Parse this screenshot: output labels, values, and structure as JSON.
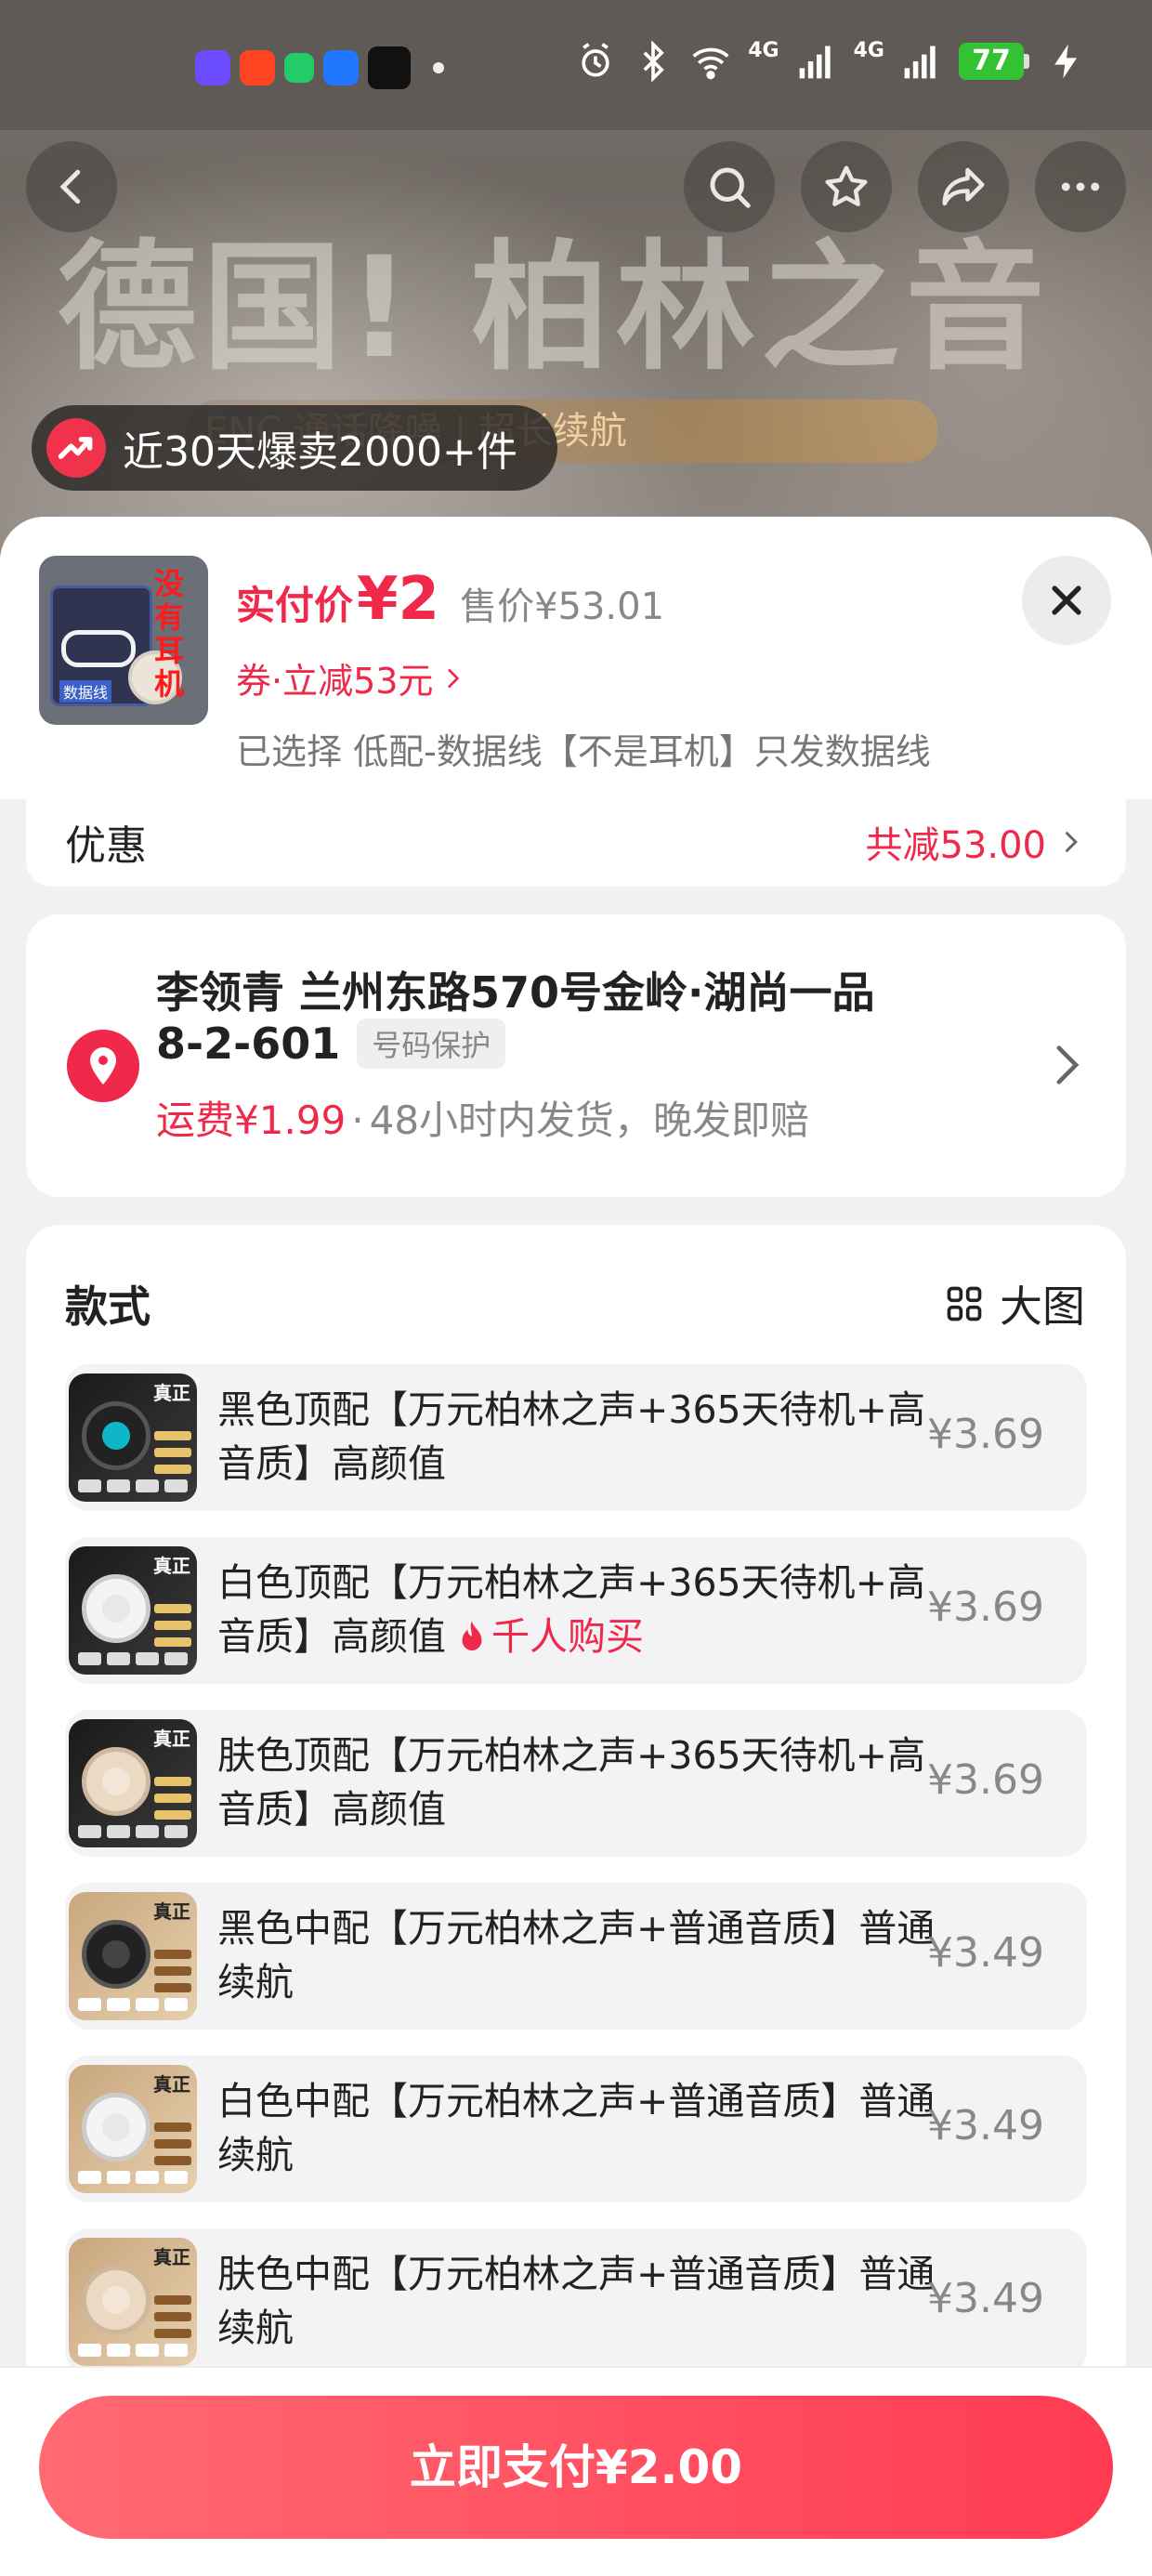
{
  "status_bar": {
    "battery": "77",
    "signal_label_1": "4G",
    "signal_label_2": "4G",
    "app_icon_colors": [
      "#6b4cff",
      "#ff4422",
      "#22cc66",
      "#2277ff",
      "#111111"
    ]
  },
  "backdrop": {
    "hero_text": "德国! 柏林之音",
    "hero_sub": "ENC 通话降噪 | 超长续航",
    "sales_badge": "近30天爆卖2000+件"
  },
  "nav": {
    "back_icon": "chevron-left-icon",
    "search_icon": "search-icon",
    "favorite_icon": "star-icon",
    "share_icon": "share-icon",
    "more_icon": "more-icon"
  },
  "product": {
    "thumb_text": "没有耳机",
    "thumb_label": "数据线",
    "price_label": "实付价",
    "price_value": "¥2",
    "original_price": "售价¥53.01",
    "coupon": "券·立减53元",
    "selected": "已选择 低配-数据线【不是耳机】只发数据线"
  },
  "discount": {
    "label": "优惠",
    "amount": "共减53.00"
  },
  "address": {
    "line1": "李领青  兰州东路570号金岭·湖尚一品",
    "line2": "8-2-601",
    "privacy_tag": "号码保护",
    "shipping_fee": "运费¥1.99",
    "separator": "·",
    "shipping_note": "48小时内发货，晚发即赔"
  },
  "styles": {
    "title": "款式",
    "big_view": "大图",
    "variants": [
      {
        "name": "黑色顶配【万元柏林之声+365天待机+高音质】高颜值",
        "price": "¥3.69",
        "badge": ""
      },
      {
        "name": "白色顶配【万元柏林之声+365天待机+高音质】高颜值",
        "price": "¥3.69",
        "badge": "千人购买"
      },
      {
        "name": "肤色顶配【万元柏林之声+365天待机+高音质】高颜值",
        "price": "¥3.69",
        "badge": ""
      },
      {
        "name": "黑色中配【万元柏林之声+普通音质】普通续航",
        "price": "¥3.49",
        "badge": ""
      },
      {
        "name": "白色中配【万元柏林之声+普通音质】普通续航",
        "price": "¥3.49",
        "badge": ""
      },
      {
        "name": "肤色中配【万元柏林之声+普通音质】普通续航",
        "price": "¥3.49",
        "badge": ""
      }
    ],
    "thumb_tag": "真正"
  },
  "footer": {
    "pay_button": "立即支付¥2.00"
  },
  "colors": {
    "accent": "#f0284a",
    "button_gradient_start": "#ff6a73",
    "button_gradient_end": "#ff3b52",
    "battery": "#33c233"
  }
}
